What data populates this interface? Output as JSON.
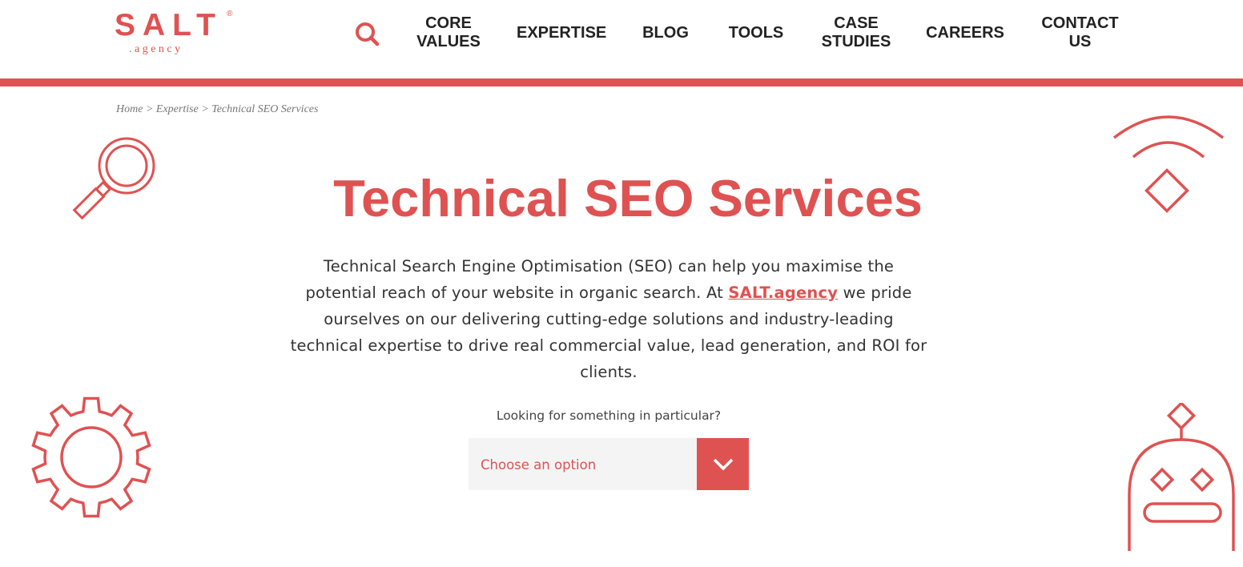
{
  "brand": {
    "name": "SALT",
    "registered": "®",
    "tagline": ".agency",
    "accent_color": "#df5252"
  },
  "nav": {
    "search_icon": "search-icon",
    "items": [
      {
        "line1": "CORE",
        "line2": "VALUES"
      },
      {
        "line1": "EXPERTISE",
        "line2": ""
      },
      {
        "line1": "BLOG",
        "line2": ""
      },
      {
        "line1": "TOOLS",
        "line2": ""
      },
      {
        "line1": "CASE",
        "line2": "STUDIES"
      },
      {
        "line1": "CAREERS",
        "line2": ""
      },
      {
        "line1": "CONTACT",
        "line2": "US"
      }
    ]
  },
  "breadcrumb": {
    "items": [
      "Home",
      "Expertise",
      "Technical SEO Services"
    ],
    "separator": ">"
  },
  "page": {
    "title": "Technical SEO Services",
    "intro_before": "Technical Search Engine Optimisation (SEO) can help you maximise the potential reach of your website in organic search. At ",
    "intro_link": "SALT.agency",
    "intro_after": " we pride ourselves on our delivering cutting-edge solutions and industry-leading technical expertise to drive real commercial value, lead generation, and ROI for clients."
  },
  "filter": {
    "label": "Looking for something in particular?",
    "selected": "Choose an option",
    "button_icon": "chevron-down-icon"
  },
  "decorations": [
    "magnifier-icon",
    "wifi-diamond-icon",
    "gear-icon",
    "robot-icon"
  ]
}
